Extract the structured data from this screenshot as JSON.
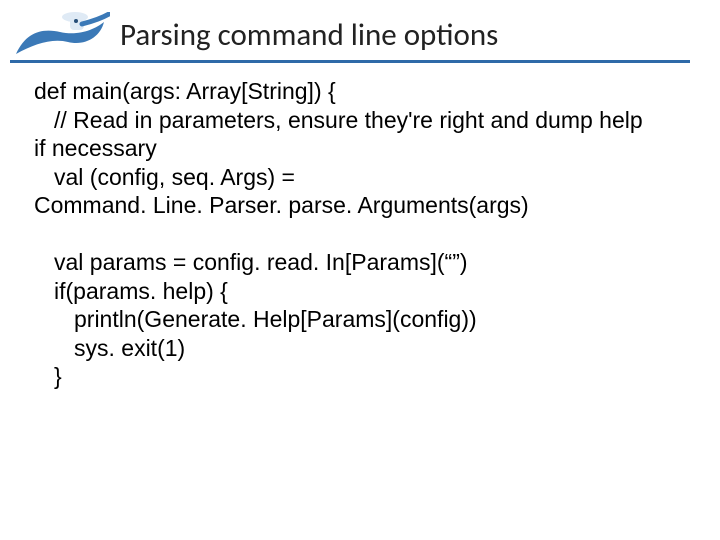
{
  "title": "Parsing command line options",
  "code": {
    "l1": "def main(args: Array[String]) {",
    "l2": "// Read in parameters, ensure they're right and dump help",
    "l3": "if necessary",
    "l4": "val (config, seq. Args) =",
    "l5": "Command. Line. Parser. parse. Arguments(args)",
    "l6": "val params = config. read. In[Params](“”)",
    "l7": "if(params. help) {",
    "l8": "println(Generate. Help[Params](config))",
    "l9": "sys. exit(1)",
    "l10": "}"
  }
}
